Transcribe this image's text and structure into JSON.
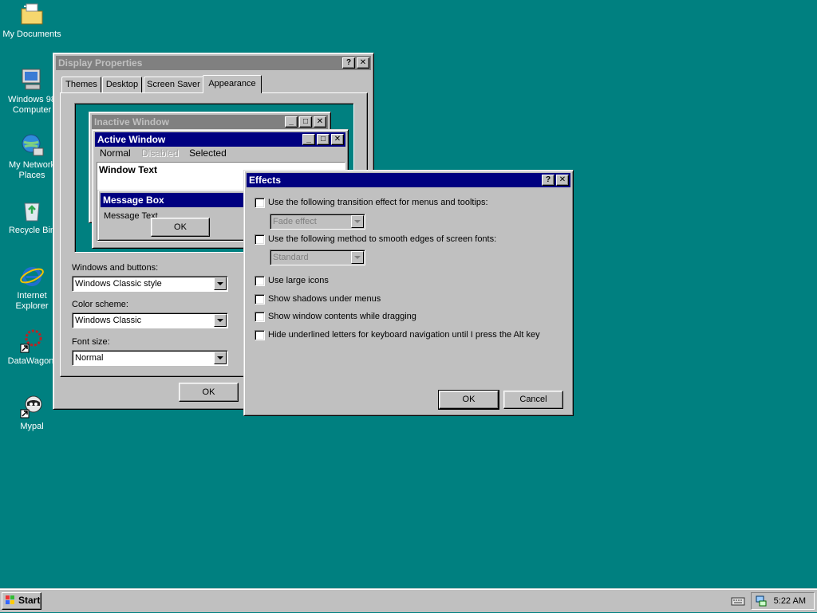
{
  "desktop": {
    "icons": [
      {
        "label": "My Documents",
        "icon": "folder-icon"
      },
      {
        "label": "Windows 98 Computer",
        "icon": "computer-icon"
      },
      {
        "label": "My Network Places",
        "icon": "network-icon"
      },
      {
        "label": "Recycle Bin",
        "icon": "recycle-bin-icon"
      },
      {
        "label": "Internet Explorer",
        "icon": "internet-explorer-icon"
      },
      {
        "label": "DataWagon.",
        "icon": "datawagon-icon"
      },
      {
        "label": "Mypal",
        "icon": "mypal-icon"
      }
    ],
    "background_color": "#008080"
  },
  "display_properties": {
    "title": "Display Properties",
    "help_glyph": "?",
    "close_glyph": "✕",
    "tabs": [
      {
        "label": "Themes"
      },
      {
        "label": "Desktop"
      },
      {
        "label": "Screen Saver"
      },
      {
        "label": "Appearance"
      }
    ],
    "selected_tab": "Appearance",
    "preview": {
      "inactive_title": "Inactive Window",
      "active_title": "Active Window",
      "menu_normal": "Normal",
      "menu_disabled": "Disabled",
      "menu_selected": "Selected",
      "window_text": "Window Text",
      "message_box_title": "Message Box",
      "message_text": "Message Text",
      "ok_label": "OK"
    },
    "windows_and_buttons_label": "Windows and buttons:",
    "windows_and_buttons_value": "Windows Classic style",
    "color_scheme_label": "Color scheme:",
    "color_scheme_value": "Windows Classic",
    "font_size_label": "Font size:",
    "font_size_value": "Normal",
    "ok_label": "OK"
  },
  "effects_dialog": {
    "title": "Effects",
    "help_glyph": "?",
    "close_glyph": "✕",
    "options": [
      {
        "label": "Use the following transition effect for menus and tooltips:",
        "checked": false
      },
      {
        "label": "Use the following method to smooth edges of screen fonts:",
        "checked": false
      },
      {
        "label": "Use large icons",
        "checked": false
      },
      {
        "label": "Show shadows under menus",
        "checked": false
      },
      {
        "label": "Show window contents while dragging",
        "checked": false
      },
      {
        "label": "Hide underlined letters for keyboard navigation until I press the Alt key",
        "checked": false
      }
    ],
    "transition_value": "Fade effect",
    "smoothing_value": "Standard",
    "ok_label": "OK",
    "cancel_label": "Cancel"
  },
  "taskbar": {
    "start_label": "Start",
    "clock": "5:22 AM"
  },
  "colors": {
    "active_title": "#000080",
    "inactive_title": "#808080",
    "face": "#c0c0c0"
  }
}
